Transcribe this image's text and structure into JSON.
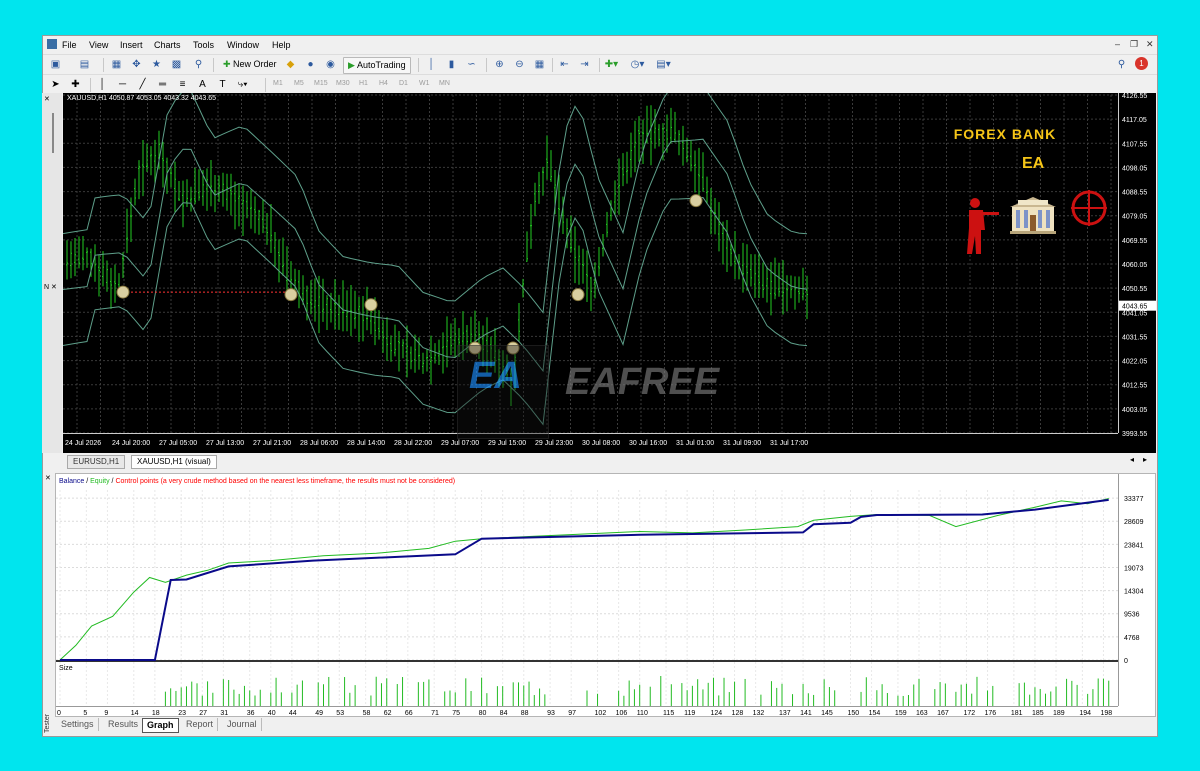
{
  "menu": [
    "File",
    "View",
    "Insert",
    "Charts",
    "Tools",
    "Window",
    "Help"
  ],
  "toolbar": {
    "new_order": "New Order",
    "auto_trading": "AutoTrading"
  },
  "timeframes": [
    "M1",
    "M5",
    "M15",
    "M30",
    "H1",
    "H4",
    "D1",
    "W1",
    "MN"
  ],
  "chart": {
    "symbol_header": "XAUUSD,H1  4050.87 4053.05 4043.32 4043.65",
    "current_price": "4043.65",
    "price_labels": [
      "4126.55",
      "4117.05",
      "4107.55",
      "4098.05",
      "4088.55",
      "4079.05",
      "4069.55",
      "4060.05",
      "4050.55",
      "4041.05",
      "4031.55",
      "4022.05",
      "4012.55",
      "4003.05",
      "3993.55"
    ],
    "time_labels": [
      "24 Jul 2026",
      "24 Jul 20:00",
      "27 Jul 05:00",
      "27 Jul 13:00",
      "27 Jul 21:00",
      "28 Jul 06:00",
      "28 Jul 14:00",
      "28 Jul 22:00",
      "29 Jul 07:00",
      "29 Jul 15:00",
      "29 Jul 23:00",
      "30 Jul 08:00",
      "30 Jul 16:00",
      "31 Jul 01:00",
      "31 Jul 09:00",
      "31 Jul 17:00"
    ],
    "tabs": [
      "EURUSD,H1",
      "XAUUSD,H1 (visual)"
    ],
    "active_tab": 1,
    "overlay_title": "FOREX BANK",
    "overlay_subtitle": "EA",
    "watermark": "EAFREE",
    "watermark_logo": "EA"
  },
  "tester": {
    "legend_balance": "Balance",
    "legend_sep1": " / ",
    "legend_equity": "Equity",
    "legend_sep2": " / ",
    "legend_control": "Control points (a very crude method based on the nearest less timeframe, the results must not be considered)",
    "size_label": "Size",
    "y_labels": [
      "33377",
      "28609",
      "23841",
      "19073",
      "14304",
      "9536",
      "4768",
      "0"
    ],
    "x_labels": [
      "0",
      "5",
      "9",
      "14",
      "18",
      "23",
      "27",
      "31",
      "36",
      "40",
      "44",
      "49",
      "53",
      "58",
      "62",
      "66",
      "71",
      "75",
      "80",
      "84",
      "88",
      "93",
      "97",
      "102",
      "106",
      "110",
      "115",
      "119",
      "124",
      "128",
      "132",
      "137",
      "141",
      "145",
      "150",
      "154",
      "159",
      "163",
      "167",
      "172",
      "176",
      "181",
      "185",
      "189",
      "194",
      "198"
    ],
    "side_label": "Tester",
    "tabs": [
      "Settings",
      "Results",
      "Graph",
      "Report",
      "Journal"
    ],
    "active_tab": 2,
    "colors": {
      "balance": "#0a0a8a",
      "equity": "#22bb22",
      "control": "#ff0000"
    }
  }
}
